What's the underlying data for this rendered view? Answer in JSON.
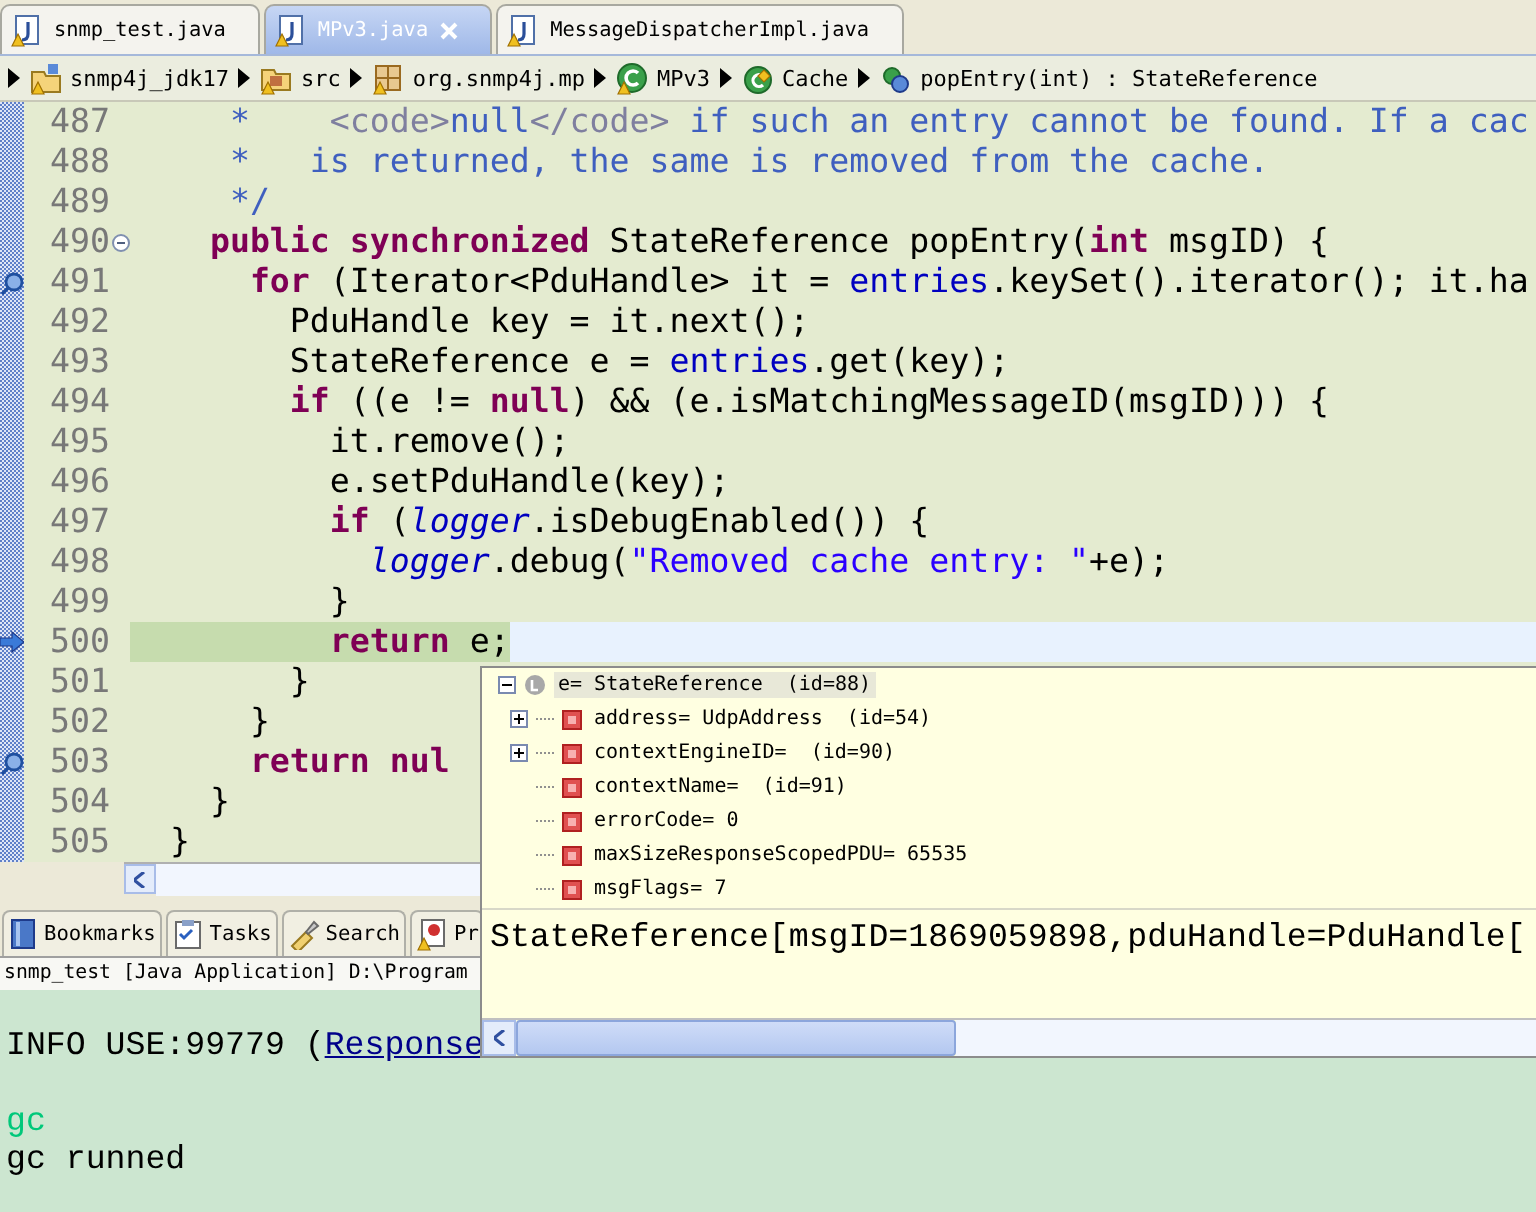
{
  "editor_tabs": [
    {
      "label": "snmp_test.java",
      "selected": false
    },
    {
      "label": "MPv3.java",
      "selected": true
    },
    {
      "label": "MessageDispatcherImpl.java",
      "selected": false
    }
  ],
  "breadcrumb": [
    {
      "kind": "project",
      "label": "snmp4j_jdk17"
    },
    {
      "kind": "source-folder",
      "label": "src"
    },
    {
      "kind": "package",
      "label": "org.snmp4j.mp"
    },
    {
      "kind": "class",
      "label": "MPv3"
    },
    {
      "kind": "static-class",
      "label": "Cache"
    },
    {
      "kind": "method",
      "label": "popEntry(int) : StateReference"
    }
  ],
  "code_lines": [
    {
      "number": "487",
      "current": false,
      "tokens": [
        {
          "kind": "comment",
          "text": "     *    "
        },
        {
          "kind": "doctag",
          "text": "<code>"
        },
        {
          "kind": "comment",
          "text": "null"
        },
        {
          "kind": "doctag",
          "text": "</code>"
        },
        {
          "kind": "comment",
          "text": " if such an entry cannot be found. If a cac"
        }
      ]
    },
    {
      "number": "488",
      "current": false,
      "tokens": [
        {
          "kind": "comment",
          "text": "     *   is returned, the same is removed from the cache."
        }
      ]
    },
    {
      "number": "489",
      "current": false,
      "tokens": [
        {
          "kind": "comment",
          "text": "     */"
        }
      ]
    },
    {
      "number": "490",
      "current": false,
      "marker": {
        "kind": "collapse"
      },
      "tokens": [
        {
          "kind": "keyword",
          "text": "    public synchronized"
        },
        {
          "kind": "plain",
          "text": " StateReference popEntry("
        },
        {
          "kind": "keyword",
          "text": "int"
        },
        {
          "kind": "plain",
          "text": " msgID) {"
        }
      ]
    },
    {
      "number": "491",
      "current": false,
      "marker": {
        "kind": "watch"
      },
      "tokens": [
        {
          "kind": "keyword",
          "text": "      for"
        },
        {
          "kind": "plain",
          "text": " (Iterator<PduHandle> it = "
        },
        {
          "kind": "field",
          "text": "entries"
        },
        {
          "kind": "plain",
          "text": ".keySet().iterator(); it.ha"
        }
      ]
    },
    {
      "number": "492",
      "current": false,
      "tokens": [
        {
          "kind": "plain",
          "text": "        PduHandle key = it.next();"
        }
      ]
    },
    {
      "number": "493",
      "current": false,
      "tokens": [
        {
          "kind": "plain",
          "text": "        StateReference e = "
        },
        {
          "kind": "field",
          "text": "entries"
        },
        {
          "kind": "plain",
          "text": ".get(key);"
        }
      ]
    },
    {
      "number": "494",
      "current": false,
      "tokens": [
        {
          "kind": "keyword",
          "text": "        if"
        },
        {
          "kind": "plain",
          "text": " ((e != "
        },
        {
          "kind": "keyword",
          "text": "null"
        },
        {
          "kind": "plain",
          "text": ") && (e.isMatchingMessageID(msgID))) {"
        }
      ]
    },
    {
      "number": "495",
      "current": false,
      "tokens": [
        {
          "kind": "plain",
          "text": "          it.remove();"
        }
      ]
    },
    {
      "number": "496",
      "current": false,
      "tokens": [
        {
          "kind": "plain",
          "text": "          e.setPduHandle(key);"
        }
      ]
    },
    {
      "number": "497",
      "current": false,
      "tokens": [
        {
          "kind": "keyword",
          "text": "          if"
        },
        {
          "kind": "plain",
          "text": " ("
        },
        {
          "kind": "static",
          "text": "logger"
        },
        {
          "kind": "plain",
          "text": ".isDebugEnabled()) {"
        }
      ]
    },
    {
      "number": "498",
      "current": false,
      "tokens": [
        {
          "kind": "static",
          "text": "            logger"
        },
        {
          "kind": "plain",
          "text": ".debug("
        },
        {
          "kind": "string",
          "text": "\"Removed cache entry: \""
        },
        {
          "kind": "plain",
          "text": "+e);"
        }
      ]
    },
    {
      "number": "499",
      "current": false,
      "tokens": [
        {
          "kind": "plain",
          "text": "          }"
        }
      ]
    },
    {
      "number": "500",
      "current": true,
      "marker": {
        "kind": "pointer"
      },
      "tokens": [
        {
          "kind": "keyword",
          "text": "          return"
        },
        {
          "kind": "plain",
          "text": " e;"
        }
      ]
    },
    {
      "number": "501",
      "current": false,
      "tokens": [
        {
          "kind": "plain",
          "text": "        }"
        }
      ]
    },
    {
      "number": "502",
      "current": false,
      "tokens": [
        {
          "kind": "plain",
          "text": "      }"
        }
      ]
    },
    {
      "number": "503",
      "current": false,
      "marker": {
        "kind": "watch"
      },
      "tokens": [
        {
          "kind": "keyword",
          "text": "      return nul"
        }
      ]
    },
    {
      "number": "504",
      "current": false,
      "tokens": [
        {
          "kind": "plain",
          "text": "    }"
        }
      ]
    },
    {
      "number": "505",
      "current": false,
      "tokens": [
        {
          "kind": "plain",
          "text": "  }"
        }
      ]
    }
  ],
  "view_tabs": [
    {
      "kind": "bookmarks",
      "label": "Bookmarks",
      "selected": false
    },
    {
      "kind": "tasks",
      "label": "Tasks",
      "selected": false
    },
    {
      "kind": "search",
      "label": "Search",
      "selected": false
    },
    {
      "kind": "problems",
      "label": "Pr",
      "selected": false
    }
  ],
  "console": {
    "title": "snmp_test [Java Application] D:\\Program",
    "lines": [
      {
        "segments": [
          {
            "kind": "out",
            "text": "INFO USE:99779 ("
          },
          {
            "kind": "link",
            "text": "Response"
          }
        ]
      },
      {
        "segments": [
          {
            "kind": "err",
            "text": "gc"
          }
        ]
      },
      {
        "segments": [
          {
            "kind": "out",
            "text": "gc runned"
          }
        ]
      }
    ]
  },
  "inspect_popup": {
    "variables": [
      {
        "label": "e= StateReference  (id=88)",
        "kind": "local",
        "expanded": true,
        "selected": true,
        "children": [
          {
            "label": "address= UdpAddress  (id=54)",
            "kind": "field",
            "expanded": false,
            "selected": false
          },
          {
            "label": "contextEngineID=  (id=90)",
            "kind": "field",
            "expanded": false,
            "selected": false
          },
          {
            "label": "contextName=  (id=91)",
            "kind": "field",
            "selected": false
          },
          {
            "label": "errorCode= 0",
            "kind": "field",
            "selected": false
          },
          {
            "label": "maxSizeResponseScopedPDU= 65535",
            "kind": "field",
            "selected": false
          },
          {
            "label": "msgFlags= 7",
            "kind": "field",
            "selected": false
          }
        ]
      }
    ],
    "detail": "StateReference[msgID=1869059898,pduHandle=PduHandle["
  }
}
